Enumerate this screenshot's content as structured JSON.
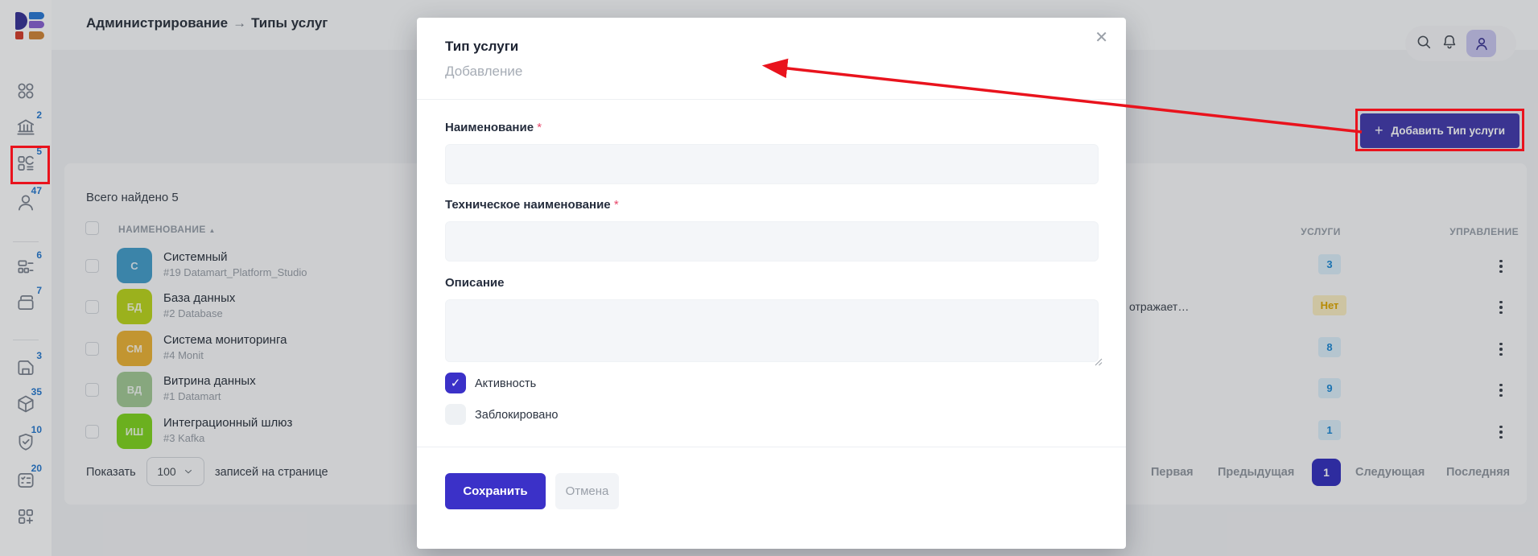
{
  "header": {
    "breadcrumb_section": "Администрирование",
    "breadcrumb_arrow": "→",
    "breadcrumb_page": "Типы услуг",
    "add_button_plus": "+",
    "add_button_label": "Добавить Тип услуги"
  },
  "sidebar": {
    "items": [
      {
        "icon": "apps-grid-icon",
        "badge": ""
      },
      {
        "icon": "bank-icon",
        "badge": "2"
      },
      {
        "icon": "service-types-icon",
        "badge": "5"
      },
      {
        "icon": "user-icon",
        "badge": "47"
      },
      {
        "icon": "registry-icon",
        "badge": "6"
      },
      {
        "icon": "folders-icon",
        "badge": "7"
      },
      {
        "icon": "archive-icon",
        "badge": "3"
      },
      {
        "icon": "cube-icon",
        "badge": "35"
      },
      {
        "icon": "shield-check-icon",
        "badge": "10"
      },
      {
        "icon": "checklist-icon",
        "badge": "20"
      },
      {
        "icon": "grid-plus-icon",
        "badge": ""
      }
    ]
  },
  "table": {
    "total_text": "Всего найдено 5",
    "columns": {
      "name": "НАИМЕНОВАНИЕ",
      "sort": "▲",
      "services": "УСЛУГИ",
      "management": "УПРАВЛЕНИЕ"
    },
    "rows": [
      {
        "initials": "С",
        "avatar_color": "#479fcc",
        "title": "Системный",
        "subtitle": "#19 Datamart_Platform_Studio",
        "services": "3"
      },
      {
        "initials": "БД",
        "avatar_color": "#bdd71f",
        "title": "База данных",
        "subtitle": "#2 Database",
        "services": "Нет",
        "description_fragment": "отражает…"
      },
      {
        "initials": "СМ",
        "avatar_color": "#edb438",
        "title": "Система мониторинга",
        "subtitle": "#4 Monit",
        "services": "8"
      },
      {
        "initials": "ВД",
        "avatar_color": "#a4cb97",
        "title": "Витрина данных",
        "subtitle": "#1 Datamart",
        "services": "9"
      },
      {
        "initials": "ИШ",
        "avatar_color": "#82d622",
        "title": "Интеграционный шлюз",
        "subtitle": "#3 Kafka",
        "services": "1"
      }
    ],
    "footer": {
      "show_label": "Показать",
      "page_size": "100",
      "per_page_label": "записей на странице",
      "pagination": {
        "first": "Первая",
        "prev": "Предыдущая",
        "current": "1",
        "next": "Следующая",
        "last": "Последняя"
      }
    }
  },
  "modal": {
    "title": "Тип услуги",
    "subtitle": "Добавление",
    "close_glyph": "✕",
    "required_mark": "*",
    "fields": [
      {
        "label": "Наименование",
        "value": "",
        "required": true
      },
      {
        "label": "Техническое наименование",
        "value": "",
        "required": true
      },
      {
        "label": "Описание",
        "value": "",
        "required": false
      }
    ],
    "checkboxes": [
      {
        "label": "Активность",
        "checked": true,
        "check_glyph": "✓"
      },
      {
        "label": "Заблокировано",
        "checked": false
      }
    ],
    "save_label": "Сохранить",
    "cancel_label": "Отмена"
  },
  "colors": {
    "primary": "#3b31c8",
    "annotation_red": "#e9131d",
    "badge_blue_bg": "#ddeffb",
    "badge_blue_text": "#1f8ad6",
    "badge_none_bg": "#fbeec3",
    "badge_none_text": "#dfa800"
  }
}
